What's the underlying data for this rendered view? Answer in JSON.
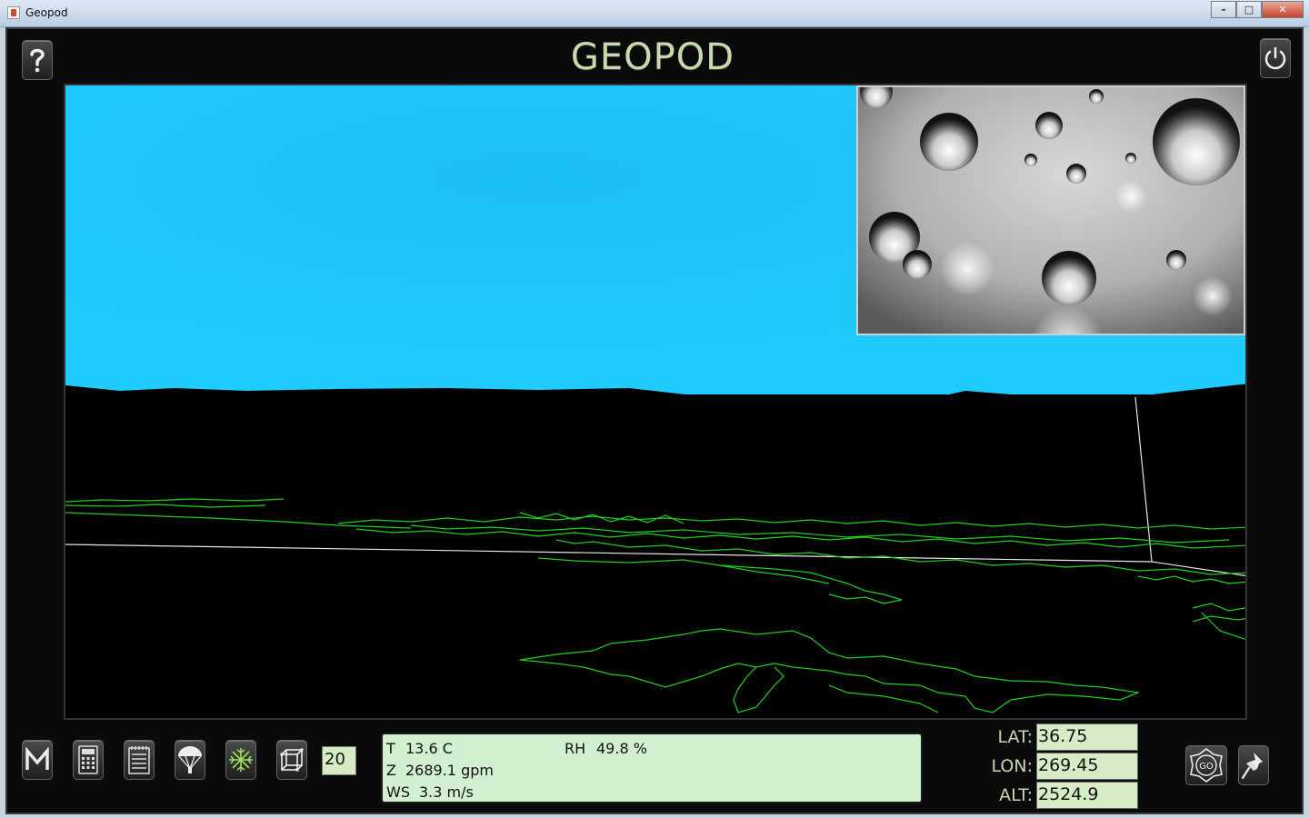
{
  "window": {
    "title": "Geopod",
    "min_label": "–",
    "max_label": "□",
    "close_label": "✕"
  },
  "header": {
    "logo_text": "GEOPOD",
    "help_icon": "question-icon",
    "power_icon": "power-icon"
  },
  "toolbar": {
    "tools": [
      {
        "name": "menu-button",
        "icon": "m-icon"
      },
      {
        "name": "calculator-button",
        "icon": "calculator-icon"
      },
      {
        "name": "notepad-button",
        "icon": "notepad-icon"
      },
      {
        "name": "parachute-button",
        "icon": "parachute-icon"
      },
      {
        "name": "snowflake-button",
        "icon": "snowflake-icon"
      },
      {
        "name": "cube-button",
        "icon": "cube-icon"
      }
    ],
    "step_value": "20"
  },
  "readout": {
    "t_label": "T",
    "t_value": "13.6 C",
    "rh_label": "RH",
    "rh_value": "49.8 %",
    "z_label": "Z",
    "z_value": "2689.1 gpm",
    "ws_label": "WS",
    "ws_value": "3.3 m/s"
  },
  "coords": {
    "lat_label": "LAT:",
    "lat_value": "36.75",
    "lon_label": "LON:",
    "lon_value": "269.45",
    "alt_label": "ALT:",
    "alt_value": "2524.9"
  },
  "nav": {
    "go_label": "GO",
    "go_icon": "go-compass-icon",
    "pin_icon": "pushpin-icon"
  },
  "colors": {
    "sky": "#1ec8ff",
    "map_lines": "#1fd11f",
    "panel_green": "#d2f0cf",
    "logo": "#c8d9b0"
  }
}
